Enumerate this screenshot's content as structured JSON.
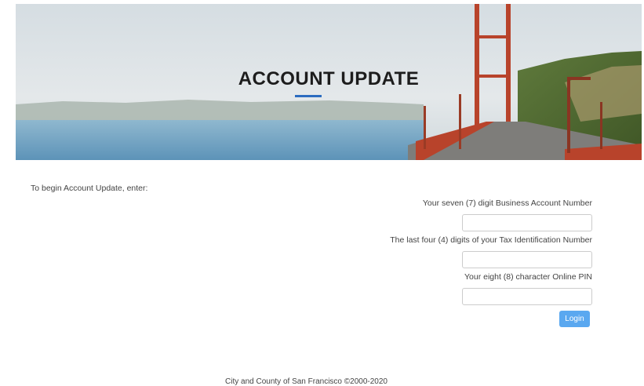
{
  "hero": {
    "title": "ACCOUNT UPDATE"
  },
  "intro_text": "To begin Account Update, enter:",
  "form": {
    "fields": [
      {
        "label": "Your seven (7) digit Business Account Number",
        "value": ""
      },
      {
        "label": "The last four (4) digits of your Tax Identification Number",
        "value": ""
      },
      {
        "label": "Your eight (8) character Online PIN",
        "value": ""
      }
    ],
    "login_label": "Login"
  },
  "footer": "City and County of San Francisco ©2000-2020",
  "colors": {
    "accent": "#2c6cc0",
    "button": "#5aa8f0",
    "bridge": "#b8432b"
  }
}
